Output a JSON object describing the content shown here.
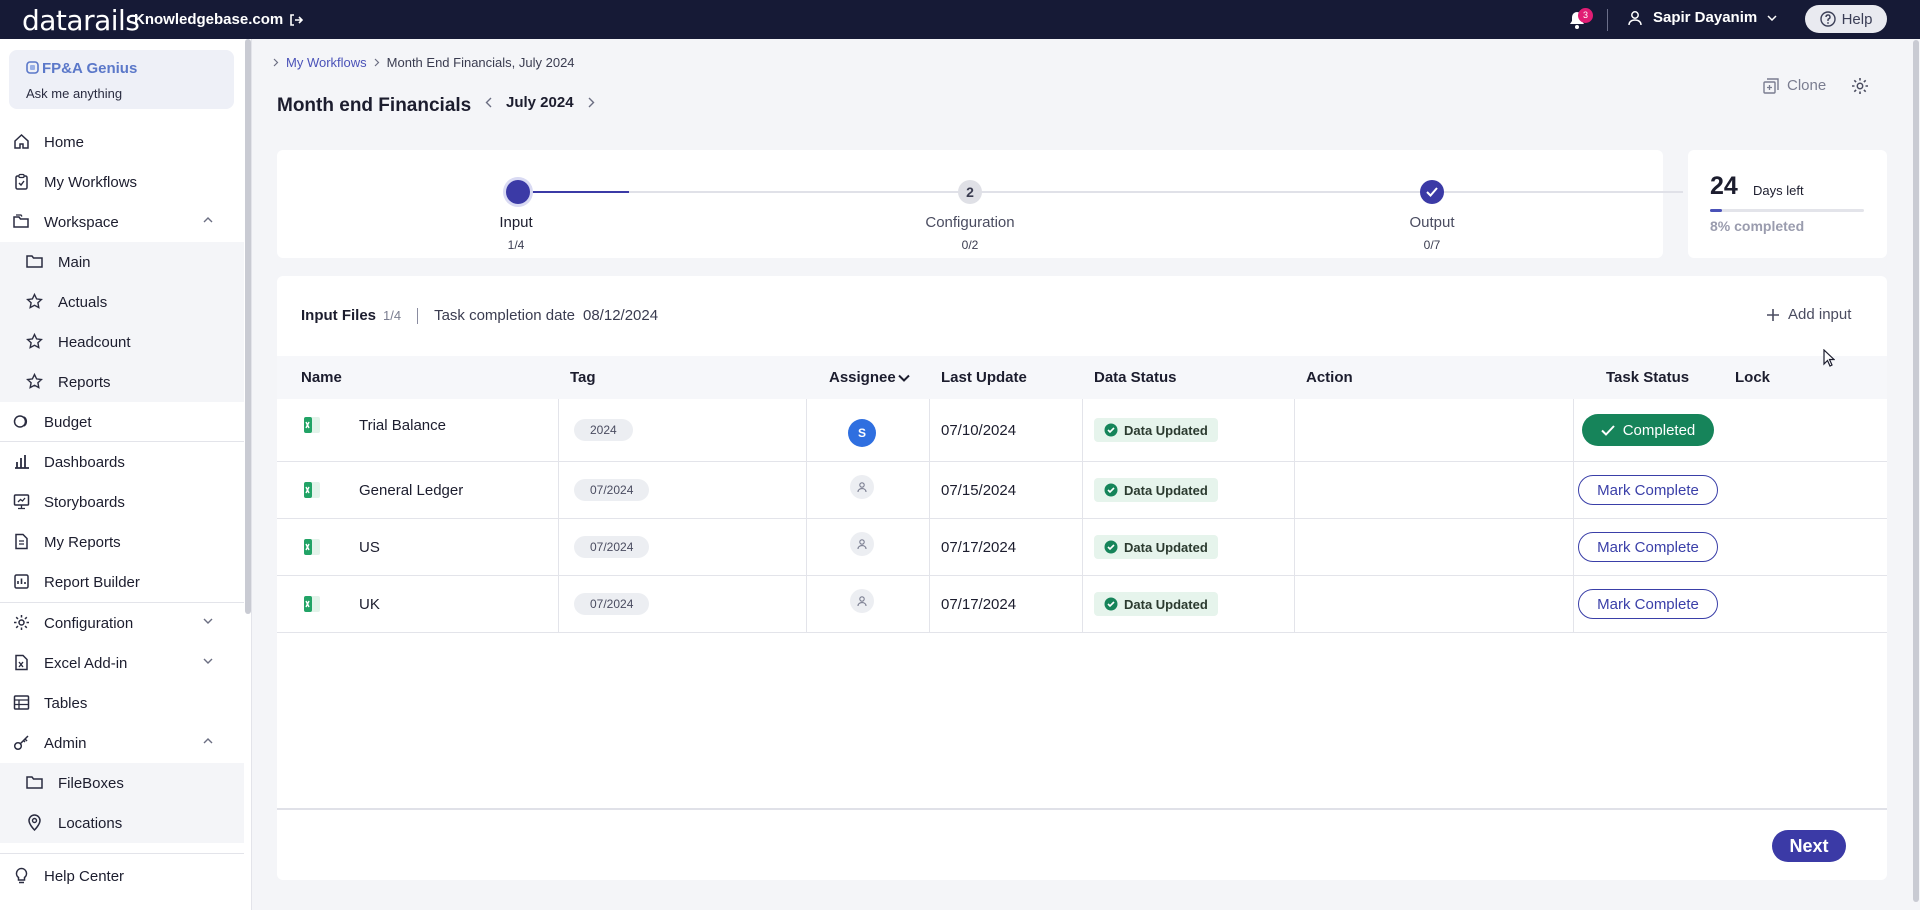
{
  "topbar": {
    "logo": "datarails",
    "site": "Knowledgebase.com",
    "notif_count": "3",
    "user_name": "Sapir Dayanim",
    "help_label": "Help"
  },
  "sidebar": {
    "genius_title": "FP&A Genius",
    "genius_sub": "Ask me anything",
    "items": [
      {
        "label": "Home"
      },
      {
        "label": "My Workflows"
      },
      {
        "label": "Workspace"
      },
      {
        "label": "Main"
      },
      {
        "label": "Actuals"
      },
      {
        "label": "Headcount"
      },
      {
        "label": "Reports"
      },
      {
        "label": "Budget"
      },
      {
        "label": "Dashboards"
      },
      {
        "label": "Storyboards"
      },
      {
        "label": "My Reports"
      },
      {
        "label": "Report Builder"
      },
      {
        "label": "Configuration"
      },
      {
        "label": "Excel Add-in"
      },
      {
        "label": "Tables"
      },
      {
        "label": "Admin"
      },
      {
        "label": "FileBoxes"
      },
      {
        "label": "Locations"
      },
      {
        "label": "Help Center"
      }
    ]
  },
  "breadcrumb": {
    "root": "My Workflows",
    "current": "Month End Financials, July 2024"
  },
  "page": {
    "title": "Month end Financials",
    "period": "July 2024",
    "clone_label": "Clone"
  },
  "steps": [
    {
      "num": "1",
      "label": "Input",
      "count": "1/4"
    },
    {
      "num": "2",
      "label": "Configuration",
      "count": "0/2"
    },
    {
      "num": "3",
      "label": "Output",
      "count": "0/7"
    }
  ],
  "days": {
    "number": "24",
    "label": "Days left",
    "pct_label": "8% completed",
    "progress": 0.08
  },
  "input_files": {
    "title": "Input Files",
    "count": "1/4",
    "completion_label": "Task completion date",
    "completion_date": "08/12/2024",
    "add_label": "Add input"
  },
  "table": {
    "headers": [
      "Name",
      "Tag",
      "Assignee",
      "Last Update",
      "Data Status",
      "Action",
      "Task Status",
      "Lock"
    ],
    "rows": [
      {
        "name": "Trial Balance",
        "tag": "2024",
        "assignee": "S",
        "last_update": "07/10/2024",
        "data_status": "Data Updated",
        "task_status": "Completed"
      },
      {
        "name": "General Ledger",
        "tag": "07/2024",
        "assignee": "",
        "last_update": "07/15/2024",
        "data_status": "Data Updated",
        "task_status": "Mark Complete"
      },
      {
        "name": "US",
        "tag": "07/2024",
        "assignee": "",
        "last_update": "07/17/2024",
        "data_status": "Data Updated",
        "task_status": "Mark Complete"
      },
      {
        "name": "UK",
        "tag": "07/2024",
        "assignee": "",
        "last_update": "07/17/2024",
        "data_status": "Data Updated",
        "task_status": "Mark Complete"
      }
    ]
  },
  "footer": {
    "next_label": "Next"
  },
  "colors": {
    "brand": "#161a36",
    "accent": "#3b3aa6",
    "success": "#16845a"
  }
}
